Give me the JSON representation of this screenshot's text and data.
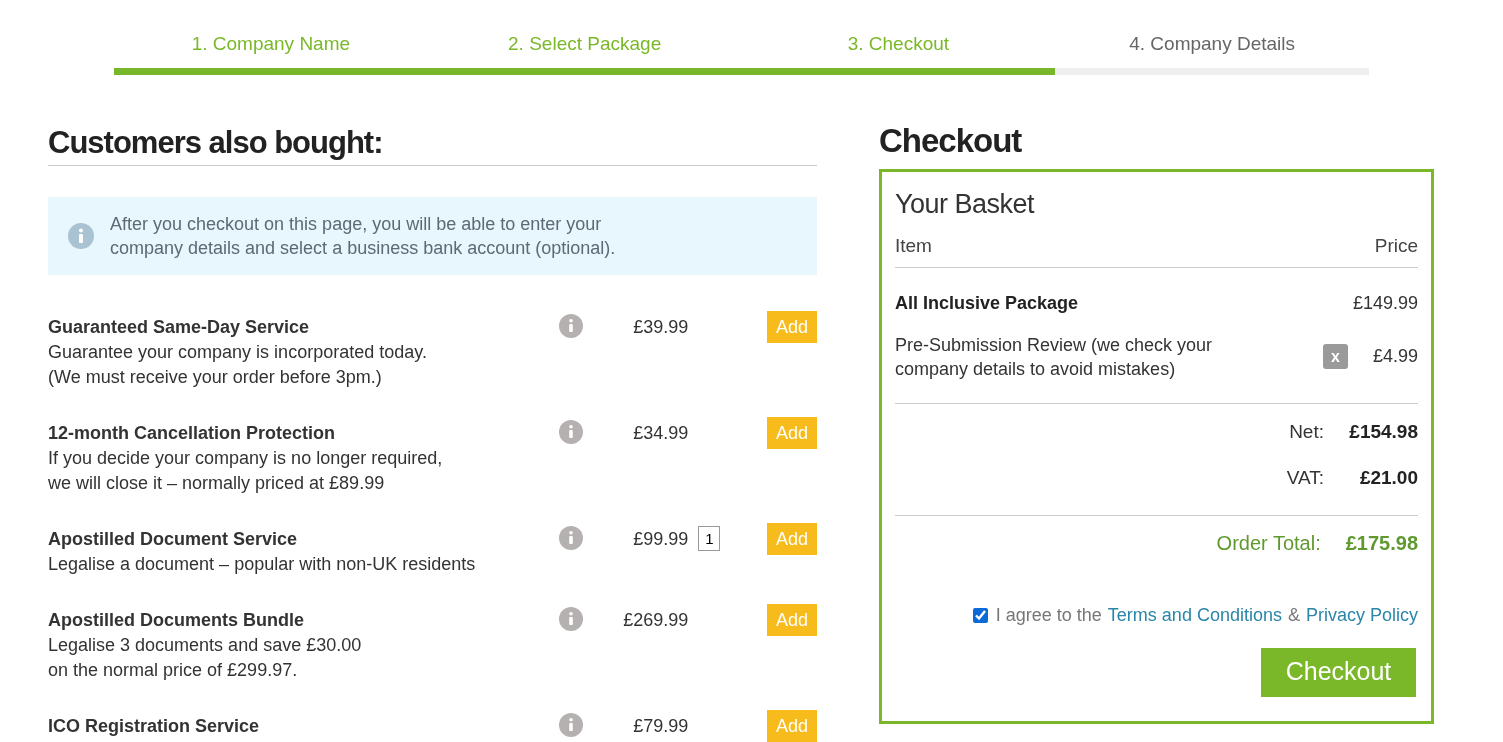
{
  "steps": [
    {
      "label": "1. Company Name",
      "completed": true
    },
    {
      "label": "2. Select Package",
      "completed": true
    },
    {
      "label": "3. Checkout",
      "completed": true
    },
    {
      "label": "4. Company Details",
      "completed": false
    }
  ],
  "upsell": {
    "title": "Customers also bought:",
    "notice": "After you checkout on this page, you will be able to enter your company details and select a business bank account (optional).",
    "items": [
      {
        "name": "Guaranteed Same-Day Service",
        "description": [
          "Guarantee your company is incorporated today.",
          "(We must receive your order before 3pm.)"
        ],
        "price": "£39.99",
        "button": "Add"
      },
      {
        "name": "12-month Cancellation Protection",
        "description": [
          "If you decide your company is no longer required,",
          "we will close it – normally priced at £89.99"
        ],
        "price": "£34.99",
        "button": "Add"
      },
      {
        "name": "Apostilled Document Service",
        "description": [
          "Legalise a document – popular with non-UK residents"
        ],
        "price": "£99.99",
        "quantity": "1",
        "button": "Add"
      },
      {
        "name": "Apostilled Documents Bundle",
        "description": [
          "Legalise 3 documents and save £30.00",
          "on the normal price of £299.97."
        ],
        "price": "£269.99",
        "button": "Add"
      },
      {
        "name": "ICO Registration Service",
        "price": "£79.99",
        "button": "Add"
      }
    ]
  },
  "checkout": {
    "title": "Checkout",
    "basket_title": "Your Basket",
    "columns": [
      "Item",
      "Price"
    ],
    "lines": [
      {
        "kind": "package",
        "name": "All Inclusive Package",
        "price": "£149.99"
      },
      {
        "kind": "extra",
        "name": "Pre-Submission Review (we check your company details to avoid mistakes)",
        "price": "£4.99",
        "remove": "x"
      }
    ],
    "totals": [
      {
        "kind": "subtotal",
        "label": "Net:",
        "value": "£154.98"
      },
      {
        "kind": "subtotal",
        "label": "VAT:",
        "value": "£21.00"
      },
      {
        "kind": "grand",
        "label": "Order Total:",
        "value": "£175.98"
      }
    ],
    "agree": {
      "checked": true,
      "text": "I agree to the",
      "link_1": "Terms and Conditions",
      "joiner": "&",
      "link_2": "Privacy Policy"
    },
    "button": "Checkout"
  }
}
